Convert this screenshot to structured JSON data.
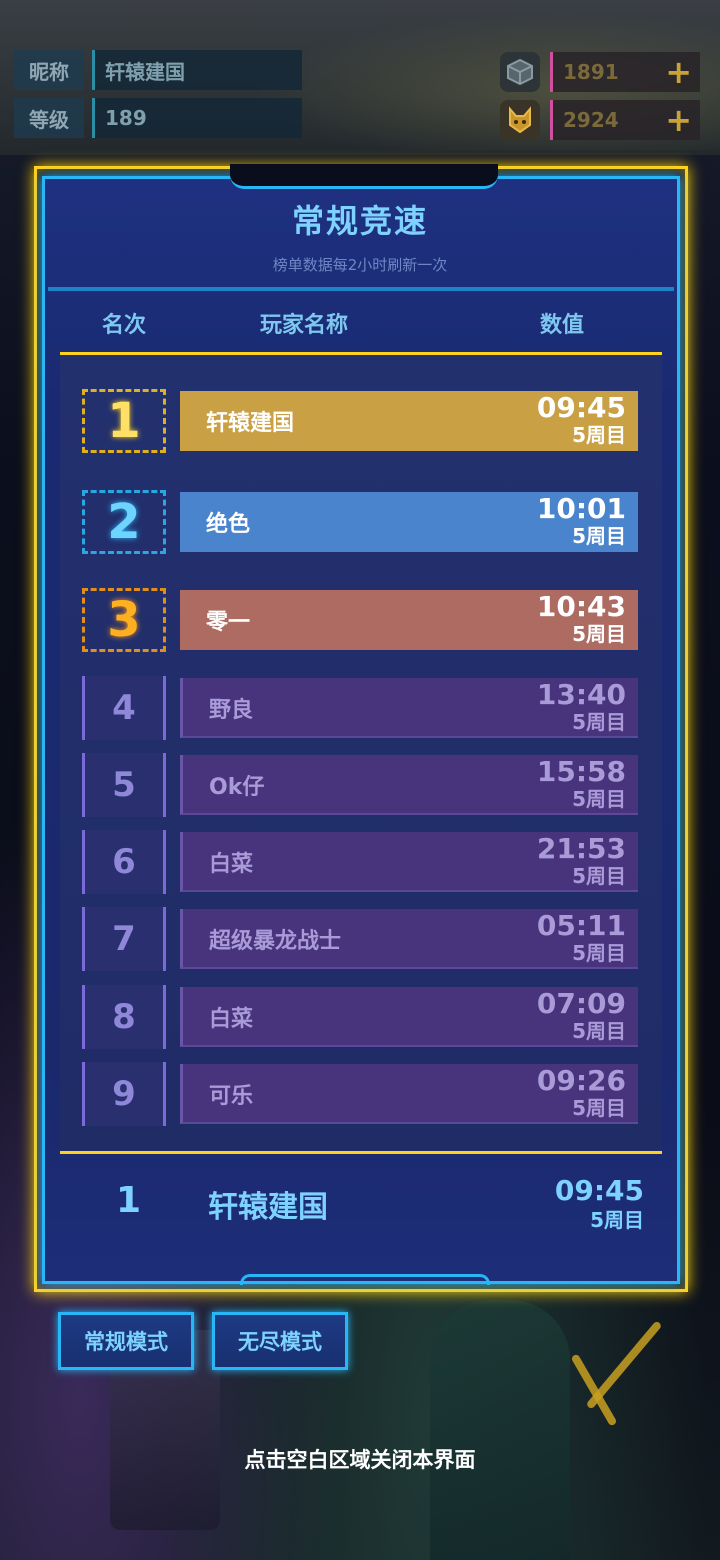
{
  "status": {
    "nickname_label": "昵称",
    "nickname": "轩辕建国",
    "level_label": "等级",
    "level": "189",
    "currency1": "1891",
    "currency2": "2924",
    "plus": "+"
  },
  "panel": {
    "title": "常规竞速",
    "subtitle": "榜单数据每2小时刷新一次",
    "col_rank": "名次",
    "col_player": "玩家名称",
    "col_value": "数值"
  },
  "ranking": [
    {
      "rank": "1",
      "name": "轩辕建国",
      "time": "09:45",
      "week": "5周目"
    },
    {
      "rank": "2",
      "name": "绝色",
      "time": "10:01",
      "week": "5周目"
    },
    {
      "rank": "3",
      "name": "零一",
      "time": "10:43",
      "week": "5周目"
    },
    {
      "rank": "4",
      "name": "野良",
      "time": "13:40",
      "week": "5周目"
    },
    {
      "rank": "5",
      "name": "Ok仔",
      "time": "15:58",
      "week": "5周目"
    },
    {
      "rank": "6",
      "name": "白菜",
      "time": "21:53",
      "week": "5周目"
    },
    {
      "rank": "7",
      "name": "超级暴龙战士",
      "time": "05:11",
      "week": "5周目"
    },
    {
      "rank": "8",
      "name": "白菜",
      "time": "07:09",
      "week": "5周目"
    },
    {
      "rank": "9",
      "name": "可乐",
      "time": "09:26",
      "week": "5周目"
    }
  ],
  "my_rank": {
    "rank": "1",
    "name": "轩辕建国",
    "time": "09:45",
    "week": "5周目"
  },
  "modes": {
    "normal": "常规模式",
    "endless": "无尽模式"
  },
  "hint": "点击空白区域关闭本界面",
  "colors": {
    "gold": "#c9a044",
    "blue": "#4a84cc",
    "bronze": "#ad6b62",
    "purple": "#47347c",
    "accent": "#29b6f6",
    "frame": "#ffd21e"
  },
  "icons": {
    "currency1": "cube-icon",
    "currency2": "cat-icon"
  }
}
